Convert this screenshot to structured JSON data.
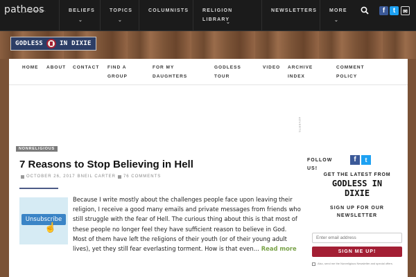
{
  "topnav": {
    "logo": "patheos",
    "items": [
      {
        "label": "BELIEFS",
        "caret": true
      },
      {
        "label": "TOPICS",
        "caret": true
      },
      {
        "label": "COLUMNISTS",
        "caret": false
      },
      {
        "label": "RELIGION",
        "label2": "LIBRARY",
        "caret": true
      },
      {
        "label": "NEWSLETTERS",
        "caret": false
      },
      {
        "label": "MORE",
        "caret": true
      }
    ],
    "caret_glyph": "⌄"
  },
  "brand": {
    "left": "GODLESS",
    "right": "IN DIXIE"
  },
  "menu": [
    {
      "l1": "HOME"
    },
    {
      "l1": "ABOUT"
    },
    {
      "l1": "CONTACT"
    },
    {
      "l1": "FIND A",
      "l2": "GROUP"
    },
    {
      "l1": "FOR MY",
      "l2": "DAUGHTERS"
    },
    {
      "l1": "GODLESS",
      "l2": "TOUR"
    },
    {
      "l1": "VIDEO"
    },
    {
      "l1": "ARCHIVE",
      "l2": "INDEX"
    },
    {
      "l1": "COMMENT",
      "l2": "POLICY"
    }
  ],
  "advert_label": "ADVERTS",
  "post": {
    "category": "NONRELIGIOUS",
    "title": "7 Reasons to Stop Believing in Hell",
    "date": "OCTOBER 26, 2017",
    "author": "BNEIL CARTER",
    "comments": "76 COMMENTS",
    "thumb_label": "Unsubscribe",
    "excerpt": "Because I write mostly about the challenges people face upon leaving their religion, I receive a good many emails and private messages from friends who still struggle with the fear of Hell. The curious thing about this is that most of these people no longer feel they have sufficient reason to believe in God. Most of them have left the religions of their youth (or of their young adult lives), yet they still fear everlasting torment. How is that even…",
    "read_more": "Read more"
  },
  "sidebar": {
    "follow_l1": "FOLLOW",
    "follow_l2": "US!",
    "latest": "GET THE LATEST FROM",
    "brand_l1": "GODLESS IN",
    "brand_l2": "DIXIE",
    "signup_l1": "SIGN UP FOR OUR",
    "signup_l2": "NEWSLETTER",
    "email_placeholder": "Enter email address",
    "signup_button": "SIGN ME UP!",
    "consent": "Also, send me the Nonreligious Newsletter and special offers."
  },
  "colors": {
    "nav_bg": "#1b1b1b",
    "brand_navy": "#2c3e66",
    "accent_red": "#a31f34",
    "read_more": "#7aa34a"
  }
}
